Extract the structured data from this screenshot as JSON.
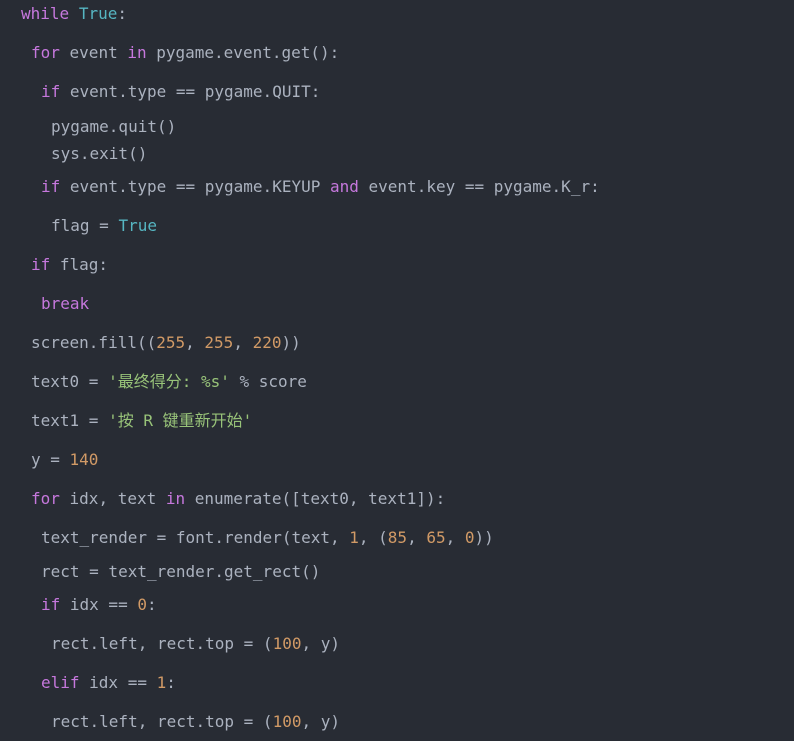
{
  "editor": {
    "theme": {
      "background": "#282c34",
      "keyword": "#c678dd",
      "builtin": "#56b6c2",
      "number": "#d19a66",
      "string": "#98c379",
      "text": "#abb2bf"
    },
    "lines": [
      {
        "indent": 0,
        "tokens": [
          [
            "kw",
            "while"
          ],
          [
            "tx",
            " "
          ],
          [
            "bi",
            "True"
          ],
          [
            "tx",
            ":"
          ]
        ]
      },
      {
        "indent": 1,
        "tokens": [
          [
            "kw",
            "for"
          ],
          [
            "tx",
            " event "
          ],
          [
            "kw",
            "in"
          ],
          [
            "tx",
            " pygame.event.get():"
          ]
        ]
      },
      {
        "indent": 2,
        "tokens": [
          [
            "kw",
            "if"
          ],
          [
            "tx",
            " event.type == pygame.QUIT:"
          ]
        ]
      },
      {
        "indent": 3,
        "tokens": [
          [
            "tx",
            "pygame.quit()"
          ]
        ]
      },
      {
        "indent": 3,
        "tokens": [
          [
            "tx",
            "sys.exit()"
          ]
        ]
      },
      {
        "indent": 2,
        "tokens": [
          [
            "kw",
            "if"
          ],
          [
            "tx",
            " event.type == pygame.KEYUP "
          ],
          [
            "kw",
            "and"
          ],
          [
            "tx",
            " event.key == pygame.K_r:"
          ]
        ]
      },
      {
        "indent": 3,
        "tokens": [
          [
            "tx",
            "flag = "
          ],
          [
            "bi",
            "True"
          ]
        ]
      },
      {
        "indent": 1,
        "tokens": [
          [
            "kw",
            "if"
          ],
          [
            "tx",
            " flag:"
          ]
        ]
      },
      {
        "indent": 2,
        "tokens": [
          [
            "kw",
            "break"
          ]
        ]
      },
      {
        "indent": 1,
        "tokens": [
          [
            "tx",
            "screen.fill(("
          ],
          [
            "num",
            "255"
          ],
          [
            "tx",
            ", "
          ],
          [
            "num",
            "255"
          ],
          [
            "tx",
            ", "
          ],
          [
            "num",
            "220"
          ],
          [
            "tx",
            "))"
          ]
        ]
      },
      {
        "indent": 1,
        "tokens": [
          [
            "tx",
            "text0 = "
          ],
          [
            "str",
            "'最终得分: %s'"
          ],
          [
            "tx",
            " % score"
          ]
        ]
      },
      {
        "indent": 1,
        "tokens": [
          [
            "tx",
            "text1 = "
          ],
          [
            "str",
            "'按 R 键重新开始'"
          ]
        ]
      },
      {
        "indent": 1,
        "tokens": [
          [
            "tx",
            "y = "
          ],
          [
            "num",
            "140"
          ]
        ]
      },
      {
        "indent": 1,
        "tokens": [
          [
            "kw",
            "for"
          ],
          [
            "tx",
            " idx, text "
          ],
          [
            "kw",
            "in"
          ],
          [
            "tx",
            " enumerate([text0, text1]):"
          ]
        ]
      },
      {
        "indent": 2,
        "tokens": [
          [
            "tx",
            "text_render = font.render(text, "
          ],
          [
            "num",
            "1"
          ],
          [
            "tx",
            ", ("
          ],
          [
            "num",
            "85"
          ],
          [
            "tx",
            ", "
          ],
          [
            "num",
            "65"
          ],
          [
            "tx",
            ", "
          ],
          [
            "num",
            "0"
          ],
          [
            "tx",
            "))"
          ]
        ]
      },
      {
        "indent": 2,
        "tokens": [
          [
            "tx",
            "rect = text_render.get_rect()"
          ]
        ]
      },
      {
        "indent": 2,
        "tokens": [
          [
            "kw",
            "if"
          ],
          [
            "tx",
            " idx == "
          ],
          [
            "num",
            "0"
          ],
          [
            "tx",
            ":"
          ]
        ]
      },
      {
        "indent": 3,
        "tokens": [
          [
            "tx",
            "rect.left, rect.top = ("
          ],
          [
            "num",
            "100"
          ],
          [
            "tx",
            ", y)"
          ]
        ]
      },
      {
        "indent": 2,
        "tokens": [
          [
            "kw",
            "elif"
          ],
          [
            "tx",
            " idx == "
          ],
          [
            "num",
            "1"
          ],
          [
            "tx",
            ":"
          ]
        ]
      },
      {
        "indent": 3,
        "tokens": [
          [
            "tx",
            "rect.left, rect.top = ("
          ],
          [
            "num",
            "100"
          ],
          [
            "tx",
            ", y)"
          ]
        ]
      }
    ]
  }
}
